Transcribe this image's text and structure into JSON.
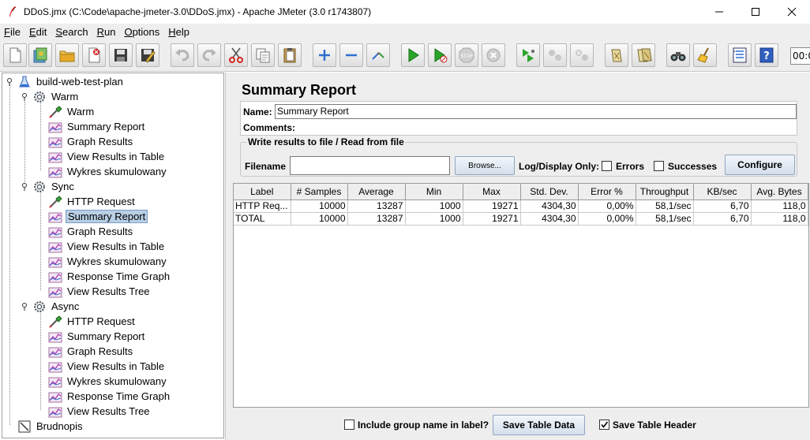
{
  "window": {
    "title": "DDoS.jmx (C:\\Code\\apache-jmeter-3.0\\DDoS.jmx) - Apache JMeter (3.0 r1743807)"
  },
  "menu": [
    {
      "label": "File",
      "key": "F",
      "rest": "ile"
    },
    {
      "label": "Edit",
      "key": "E",
      "rest": "dit"
    },
    {
      "label": "Search",
      "key": "S",
      "rest": "earch"
    },
    {
      "label": "Run",
      "key": "R",
      "rest": "un"
    },
    {
      "label": "Options",
      "key": "O",
      "rest": "ptions"
    },
    {
      "label": "Help",
      "key": "H",
      "rest": "elp"
    }
  ],
  "toolbar": {
    "timer": "00:0",
    "buttons": [
      "new-icon",
      "templates-icon",
      "open-icon",
      "close-icon",
      "save-icon",
      "save-as-icon",
      "undo-icon",
      "redo-icon",
      "cut-icon",
      "copy-icon",
      "paste-icon",
      "expand-icon",
      "collapse-icon",
      "toggle-icon",
      "start-icon",
      "start-no-pause-icon",
      "stop-icon",
      "shutdown-icon",
      "remote-start-icon",
      "remote-stop-icon",
      "remote-shutdown-icon",
      "clear-icon",
      "clear-all-icon",
      "search-icon",
      "reset-search-icon",
      "function-helper-icon",
      "help-icon"
    ]
  },
  "tree": {
    "nodes": [
      {
        "label": "build-web-test-plan",
        "type": "testplan"
      },
      {
        "label": "Warm",
        "type": "threadgroup"
      },
      {
        "label": "Warm",
        "type": "sampler"
      },
      {
        "label": "Summary Report",
        "type": "listener"
      },
      {
        "label": "Graph Results",
        "type": "listener"
      },
      {
        "label": "View Results in Table",
        "type": "listener"
      },
      {
        "label": "Wykres skumulowany",
        "type": "listener"
      },
      {
        "label": "Sync",
        "type": "threadgroup"
      },
      {
        "label": "HTTP Request",
        "type": "sampler"
      },
      {
        "label": "Summary Report",
        "type": "listener",
        "selected": true
      },
      {
        "label": "Graph Results",
        "type": "listener"
      },
      {
        "label": "View Results in Table",
        "type": "listener"
      },
      {
        "label": "Wykres skumulowany",
        "type": "listener"
      },
      {
        "label": "Response Time Graph",
        "type": "listener"
      },
      {
        "label": "View Results Tree",
        "type": "listener"
      },
      {
        "label": "Async",
        "type": "threadgroup"
      },
      {
        "label": "HTTP Request",
        "type": "sampler"
      },
      {
        "label": "Summary Report",
        "type": "listener"
      },
      {
        "label": "Graph Results",
        "type": "listener"
      },
      {
        "label": "View Results in Table",
        "type": "listener"
      },
      {
        "label": "Wykres skumulowany",
        "type": "listener"
      },
      {
        "label": "Response Time Graph",
        "type": "listener"
      },
      {
        "label": "View Results Tree",
        "type": "listener"
      },
      {
        "label": "Brudnopis",
        "type": "workbench"
      }
    ]
  },
  "panel": {
    "title": "Summary Report",
    "name_label": "Name:",
    "name_value": "Summary Report",
    "comments_label": "Comments:",
    "file_group_legend": "Write results to file / Read from file",
    "filename_label": "Filename",
    "filename_value": "",
    "browse_label": "Browse...",
    "log_display_label": "Log/Display Only:",
    "errors_label": "Errors",
    "successes_label": "Successes",
    "configure_label": "Configure"
  },
  "table": {
    "headers": [
      "Label",
      "# Samples",
      "Average",
      "Min",
      "Max",
      "Std. Dev.",
      "Error %",
      "Throughput",
      "KB/sec",
      "Avg. Bytes"
    ],
    "rows": [
      [
        "HTTP Req...",
        "10000",
        "13287",
        "1000",
        "19271",
        "4304,30",
        "0,00%",
        "58,1/sec",
        "6,70",
        "118,0"
      ],
      [
        "TOTAL",
        "10000",
        "13287",
        "1000",
        "19271",
        "4304,30",
        "0,00%",
        "58,1/sec",
        "6,70",
        "118,0"
      ]
    ]
  },
  "bottom": {
    "include_group_label": "Include group name in label?",
    "include_group_checked": false,
    "save_table_label": "Save Table Data",
    "save_header_label": "Save Table Header",
    "save_header_checked": true
  }
}
